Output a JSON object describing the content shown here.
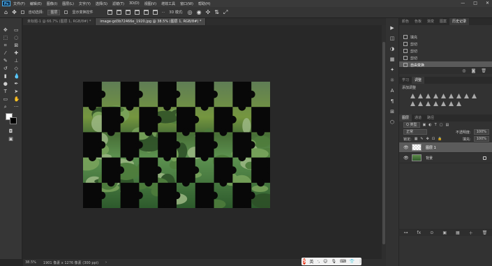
{
  "menubar": {
    "logo": "Ps",
    "items": [
      "文件(F)",
      "编辑(E)",
      "图像(I)",
      "图层(L)",
      "文字(Y)",
      "选择(S)",
      "滤镜(T)",
      "3D(D)",
      "视图(V)",
      "增效工具",
      "窗口(W)",
      "帮助(H)"
    ],
    "window_controls": [
      "—",
      "□",
      "✕"
    ]
  },
  "options": {
    "auto_select_label": "自动选择:",
    "auto_select_value": "图层",
    "show_transform_label": "显示变换控件",
    "mode_3d_label": "3D 模式:"
  },
  "tabs": [
    {
      "label": "未标题-1 @ 66.7% (图层 1, RGB/8#) *",
      "active": false
    },
    {
      "label": "image-gd3b72466e_1920.jpg @ 38.5% (图层 1, RGB/8#) *",
      "active": true
    }
  ],
  "status": {
    "zoom": "38.5%",
    "doc_info": "1901 像素 x 1276 像素 (300 ppi)",
    "arrow": "›"
  },
  "ime": {
    "logo": "S",
    "lang": "英",
    "icons": [
      "·,",
      "☺",
      "🎙",
      "⌨",
      "👕",
      "⋮⋮"
    ]
  },
  "history_panel": {
    "tabs": [
      "颜色",
      "色板",
      "渐变",
      "图案",
      "历史记录"
    ],
    "items": [
      {
        "label": "填充",
        "selected": false
      },
      {
        "label": "剪切",
        "selected": false
      },
      {
        "label": "剪切",
        "selected": false
      },
      {
        "label": "剪切",
        "selected": false
      },
      {
        "label": "自由变换",
        "selected": true
      }
    ]
  },
  "adjust_panel": {
    "tabs": [
      "学习",
      "调整"
    ],
    "title": "添加调整"
  },
  "layers_panel": {
    "tabs": [
      "图层",
      "通道",
      "路径"
    ],
    "kind_label": "Q 类型",
    "blend_mode": "正常",
    "opacity_label": "不透明度:",
    "opacity_value": "100%",
    "lock_label": "锁定:",
    "fill_label": "填充:",
    "fill_value": "100%",
    "layers": [
      {
        "name": "图层 1",
        "selected": true,
        "thumb": "transparent"
      },
      {
        "name": "背景",
        "selected": false,
        "thumb": "photo"
      }
    ],
    "footer_icons": [
      "fx",
      "⊙",
      "▣",
      "▦",
      "＋",
      "🗑"
    ]
  },
  "image": {
    "cols": 10,
    "rows": 5,
    "note_colors": [
      "#7aa45c",
      "#4f7d3c",
      "#2d4f27",
      "#9cb884"
    ]
  }
}
